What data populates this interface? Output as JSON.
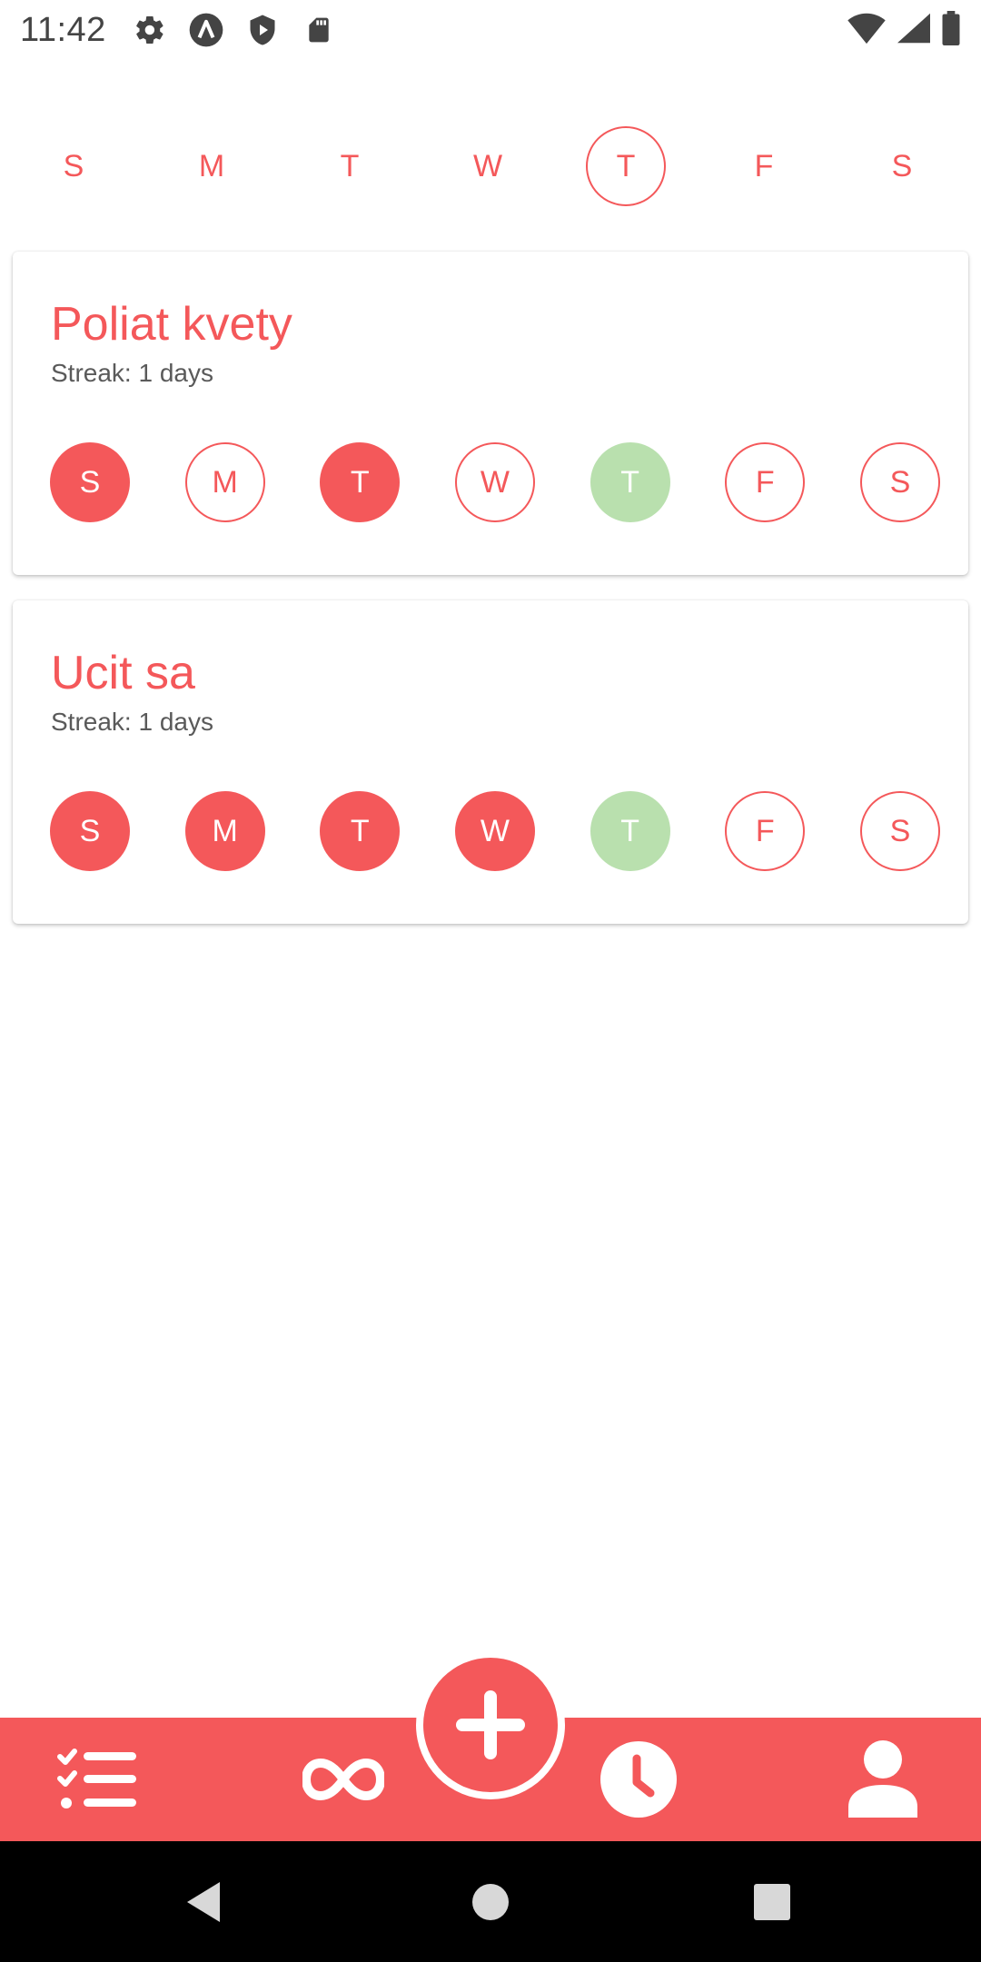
{
  "status_bar": {
    "time": "11:42",
    "icons_left": [
      "gear-icon",
      "app-a-icon",
      "shield-play-icon",
      "sd-card-icon"
    ],
    "icons_right": [
      "wifi-icon",
      "signal-icon",
      "battery-icon"
    ]
  },
  "week_header": {
    "days": [
      "S",
      "M",
      "T",
      "W",
      "T",
      "F",
      "S"
    ],
    "selected_index": 4
  },
  "habits": [
    {
      "title": "Poliat kvety",
      "streak": "Streak: 1 days",
      "days": [
        "S",
        "M",
        "T",
        "W",
        "T",
        "F",
        "S"
      ],
      "states": [
        "done",
        "empty",
        "done",
        "empty",
        "today",
        "empty",
        "empty"
      ]
    },
    {
      "title": "Ucit sa",
      "streak": "Streak: 1 days",
      "days": [
        "S",
        "M",
        "T",
        "W",
        "T",
        "F",
        "S"
      ],
      "states": [
        "done",
        "done",
        "done",
        "done",
        "today",
        "empty",
        "empty"
      ]
    }
  ],
  "bottom_nav": {
    "items": [
      "checklist-icon",
      "infinity-icon",
      "add-icon",
      "clock-icon",
      "person-icon"
    ]
  },
  "system_nav": {
    "items": [
      "back-icon",
      "home-icon",
      "recents-icon"
    ]
  },
  "colors": {
    "accent": "#f4585a",
    "today": "#b9e0ae",
    "text_secondary": "#5a5a5a"
  }
}
